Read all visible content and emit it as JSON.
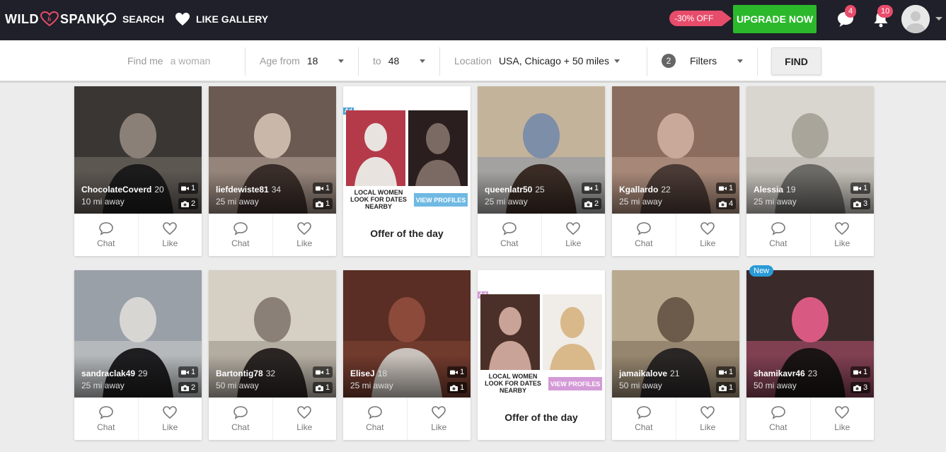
{
  "brand": {
    "left": "WILD",
    "right": "SPANK",
    "mark": "h"
  },
  "nav": {
    "search": "SEARCH",
    "like_gallery": "LIKE GALLERY"
  },
  "promo": {
    "discount": "-30% OFF",
    "upgrade": "UPGRADE NOW"
  },
  "notifications": {
    "messages": "4",
    "alerts": "10"
  },
  "filters": {
    "find_me_label": "Find me",
    "find_me_value": "a woman",
    "age_from_label": "Age from",
    "age_from_value": "18",
    "age_to_label": "to",
    "age_to_value": "48",
    "location_label": "Location",
    "location_value": "USA, Chicago + 50 miles",
    "filters_count": "2",
    "filters_label": "Filters",
    "find_button": "FIND"
  },
  "actions": {
    "chat": "Chat",
    "like": "Like"
  },
  "profiles": [
    {
      "name": "ChocolateCoverd",
      "age": "20",
      "distance": "10 mi away",
      "videos": "1",
      "photos": "2",
      "bg": [
        "#3a3633",
        "#8a8078",
        "#1c1b1c"
      ]
    },
    {
      "name": "liefdewiste81",
      "age": "34",
      "distance": "25 mi away",
      "videos": "1",
      "photos": "1",
      "bg": [
        "#6a5a52",
        "#c9b7aa",
        "#3a2e2a"
      ]
    },
    {
      "name": "queenlatr50",
      "age": "25",
      "distance": "25 mi away",
      "videos": "1",
      "photos": "2",
      "bg": [
        "#c4b39b",
        "#7d8ea8",
        "#3a2c25"
      ]
    },
    {
      "name": "Kgallardo",
      "age": "22",
      "distance": "25 mi away",
      "videos": "1",
      "photos": "4",
      "bg": [
        "#8a6d5e",
        "#c9a99a",
        "#4a3a35"
      ]
    },
    {
      "name": "Alessia",
      "age": "19",
      "distance": "25 mi away",
      "videos": "1",
      "photos": "3",
      "bg": [
        "#d9d6cf",
        "#a9a59b",
        "#6b6a66"
      ]
    },
    {
      "name": "sandraclak49",
      "age": "29",
      "distance": "25 mi away",
      "videos": "1",
      "photos": "2",
      "bg": [
        "#9aa0a8",
        "#d8d6d3",
        "#1e1d1f"
      ]
    },
    {
      "name": "Bartontig78",
      "age": "32",
      "distance": "50 mi away",
      "videos": "1",
      "photos": "1",
      "bg": [
        "#d6cfc4",
        "#8a8077",
        "#2a2523"
      ]
    },
    {
      "name": "EliseJ",
      "age": "18",
      "distance": "25 mi away",
      "videos": "1",
      "photos": "1",
      "bg": [
        "#5a2e24",
        "#8b4a3a",
        "#c9c1bb"
      ]
    },
    {
      "name": "jamaikalove",
      "age": "21",
      "distance": "50 mi away",
      "videos": "1",
      "photos": "1",
      "bg": [
        "#b9a98f",
        "#6c5b4a",
        "#2a2626"
      ]
    },
    {
      "name": "shamikavr46",
      "age": "23",
      "distance": "50 mi away",
      "videos": "1",
      "photos": "3",
      "new": "New",
      "bg": [
        "#3a2a2a",
        "#d85a82",
        "#1a1414"
      ]
    }
  ],
  "ads": [
    {
      "tag": "Ad",
      "text": "LOCAL WOMEN LOOK FOR DATES NEARBY",
      "button": "VIEW PROFILES",
      "offer": "Offer of the day",
      "button_color": "#6fb9e3",
      "tag_color": "#4ba3d4",
      "img1": [
        "#b43a4a",
        "#e8e3df"
      ],
      "img2": [
        "#2a1e1e",
        "#7a6a63"
      ]
    },
    {
      "tag": "Ad",
      "text": "LOCAL WOMEN LOOK FOR DATES NEARBY",
      "button": "VIEW PROFILES",
      "offer": "Offer of the day",
      "button_color": "#d49ad7",
      "tag_color": "#d49ad7",
      "img1": [
        "#4a3028",
        "#c9a397"
      ],
      "img2": [
        "#f0ece8",
        "#d9b88a"
      ]
    }
  ]
}
